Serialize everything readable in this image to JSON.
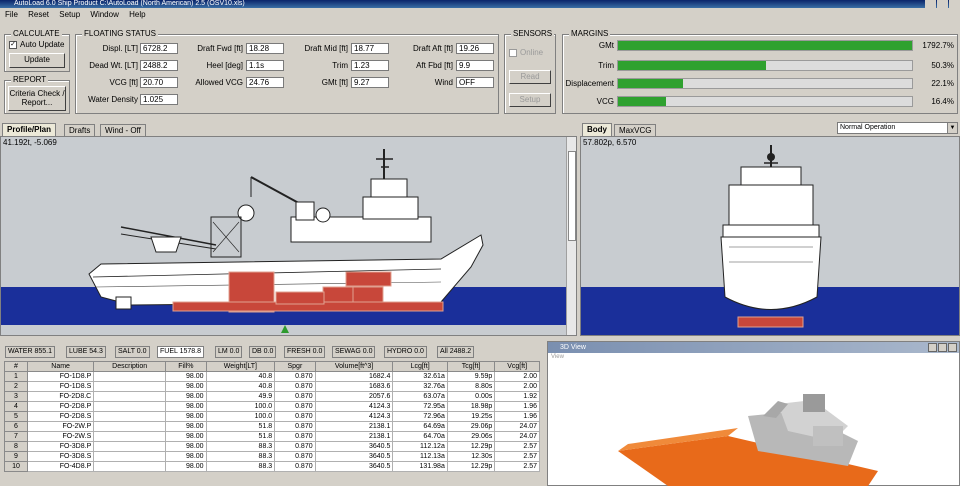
{
  "window": {
    "title": "AutoLoad 6.0 Ship Product C:\\AutoLoad (North American) 2.5 (OSV10.xls)"
  },
  "menu": [
    "File",
    "Reset",
    "Setup",
    "Window",
    "Help"
  ],
  "calculate": {
    "title": "CALCULATE",
    "auto_update_label": "Auto Update",
    "update_button": "Update"
  },
  "report": {
    "title": "REPORT",
    "criteria_button": "Criteria Check / Report..."
  },
  "floating_status": {
    "title": "FLOATING STATUS",
    "fields": [
      {
        "label": "Displ. [LT]",
        "value": "6728.2"
      },
      {
        "label": "Dead Wt. [LT]",
        "value": "2488.2"
      },
      {
        "label": "VCG [ft]",
        "value": "20.70"
      },
      {
        "label": "Water Density",
        "value": "1.025"
      },
      {
        "label": "Draft Fwd [ft]",
        "value": "18.28"
      },
      {
        "label": "Heel [deg]",
        "value": "1.1s"
      },
      {
        "label": "Allowed VCG",
        "value": "24.76"
      },
      {
        "label": "Draft Mid [ft]",
        "value": "18.77"
      },
      {
        "label": "Trim",
        "value": "1.23"
      },
      {
        "label": "GMt [ft]",
        "value": "9.27"
      },
      {
        "label": "Draft Aft [ft]",
        "value": "19.26"
      },
      {
        "label": "Aft Fbd [ft]",
        "value": "9.9"
      },
      {
        "label": "Wind",
        "value": "OFF"
      }
    ]
  },
  "sensors": {
    "title": "SENSORS",
    "online_label": "Online",
    "read_button": "Read",
    "setup_button": "Setup"
  },
  "margins": {
    "title": "MARGINS",
    "bars": [
      {
        "label": "GMt",
        "value": "1792.7%",
        "fill": 1.0
      },
      {
        "label": "Trim",
        "value": "50.3%",
        "fill": 0.503
      },
      {
        "label": "Displacement",
        "value": "22.1%",
        "fill": 0.221
      },
      {
        "label": "VCG",
        "value": "16.4%",
        "fill": 0.164
      }
    ],
    "bar_color": "#2fa12f"
  },
  "profile_tabs": [
    "Profile/Plan",
    "Drafts",
    "Wind - Off"
  ],
  "profile_coord": "41.192t, -5.069",
  "body_tabs": [
    "Body",
    "MaxVCG"
  ],
  "body_coord": "57.802p, 6.570",
  "operation_select": "Normal Operation",
  "summary_tabs": [
    "WATER 855.1",
    "LUBE 54.3",
    "SALT 0.0",
    "FUEL 1578.8",
    "LM 0.0",
    "DB 0.0",
    "FRESH 0.0",
    "SEWAG 0.0",
    "HYDRO 0.0",
    "All 2488.2"
  ],
  "active_summary_tab": 3,
  "table": {
    "columns": [
      "#",
      "Name",
      "Description",
      "Fill%",
      "Weight[LT]",
      "Spgr",
      "Volume[ft^3]",
      "Lcg[ft]",
      "Tcg[ft]",
      "Vcg[ft]"
    ],
    "rows": [
      [
        "1",
        "FO-1D8.P",
        "",
        "98.00",
        "40.8",
        "0.870",
        "1682.4",
        "32.61a",
        "9.59p",
        "2.00"
      ],
      [
        "2",
        "FO-1D8.S",
        "",
        "98.00",
        "40.8",
        "0.870",
        "1683.6",
        "32.76a",
        "8.80s",
        "2.00"
      ],
      [
        "3",
        "FO-2D8.C",
        "",
        "98.00",
        "49.9",
        "0.870",
        "2057.6",
        "63.07a",
        "0.00s",
        "1.92"
      ],
      [
        "4",
        "FO-2D8.P",
        "",
        "98.00",
        "100.0",
        "0.870",
        "4124.3",
        "72.95a",
        "18.98p",
        "1.96"
      ],
      [
        "5",
        "FO-2D8.S",
        "",
        "98.00",
        "100.0",
        "0.870",
        "4124.3",
        "72.96a",
        "19.25s",
        "1.96"
      ],
      [
        "6",
        "FO-2W.P",
        "",
        "98.00",
        "51.8",
        "0.870",
        "2138.1",
        "64.69a",
        "29.06p",
        "24.07"
      ],
      [
        "7",
        "FO-2W.S",
        "",
        "98.00",
        "51.8",
        "0.870",
        "2138.1",
        "64.70a",
        "29.06s",
        "24.07"
      ],
      [
        "8",
        "FO-3D8.P",
        "",
        "98.00",
        "88.3",
        "0.870",
        "3640.5",
        "112.12a",
        "12.29p",
        "2.57"
      ],
      [
        "9",
        "FO-3D8.S",
        "",
        "98.00",
        "88.3",
        "0.870",
        "3640.5",
        "112.13a",
        "12.30s",
        "2.57"
      ],
      [
        "10",
        "FO-4D8.P",
        "",
        "98.00",
        "88.3",
        "0.870",
        "3640.5",
        "131.98a",
        "12.29p",
        "2.57"
      ]
    ]
  },
  "view3d": {
    "title": "3D View",
    "subtitle": "View"
  },
  "colors": {
    "sea": "#1a2f9a",
    "tank": "#c8473a",
    "hull3d": "#e86a1a"
  }
}
